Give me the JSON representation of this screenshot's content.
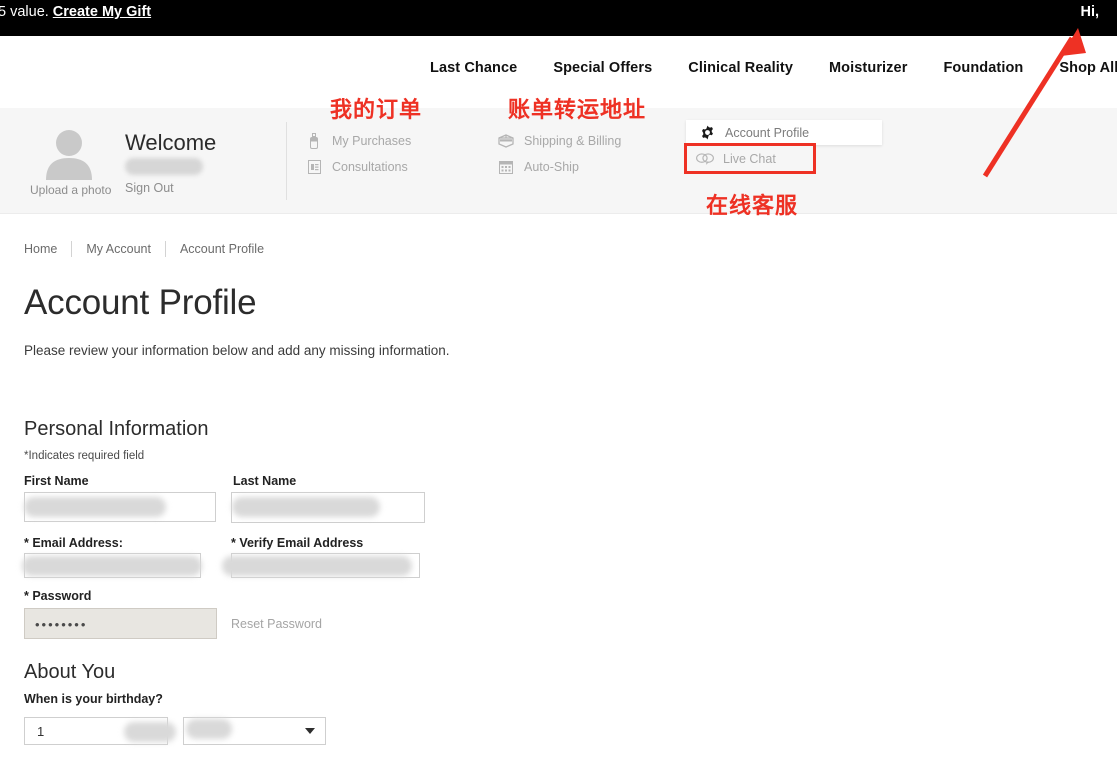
{
  "promo_bar": {
    "text": "5 value.",
    "link_label": "Create My Gift",
    "greeting": "Hi,"
  },
  "nav": {
    "items": [
      {
        "label": "Last Chance"
      },
      {
        "label": "Special Offers"
      },
      {
        "label": "Clinical Reality"
      },
      {
        "label": "Moisturizer"
      },
      {
        "label": "Foundation"
      },
      {
        "label": "Shop All"
      }
    ]
  },
  "account_band": {
    "upload_photo_label": "Upload a photo",
    "welcome_title": "Welcome",
    "sign_out_label": "Sign Out",
    "orders_column": [
      {
        "label": "My Purchases",
        "icon": "bottle-icon"
      },
      {
        "label": "Consultations",
        "icon": "document-icon"
      }
    ],
    "shipping_column": [
      {
        "label": "Shipping & Billing",
        "icon": "package-icon"
      },
      {
        "label": "Auto-Ship",
        "icon": "calendar-icon"
      }
    ],
    "dropdown": [
      {
        "label": "Account Profile",
        "icon": "gear-icon"
      },
      {
        "label": "Live Chat",
        "icon": "chat-bubble-icon"
      }
    ]
  },
  "annotations": {
    "orders_cn": "我的订单",
    "shipping_cn": "账单转运地址",
    "live_chat_cn": "在线客服",
    "color": "#ee3124"
  },
  "breadcrumb": {
    "items": [
      {
        "label": "Home"
      },
      {
        "label": "My Account"
      },
      {
        "label": "Account Profile"
      }
    ]
  },
  "page": {
    "title": "Account Profile",
    "subtitle": "Please review your information below and add any missing information."
  },
  "personal_information": {
    "heading": "Personal Information",
    "required_note": "*Indicates required field",
    "first_name_label": "First Name",
    "first_name_value": "",
    "last_name_label": "Last Name",
    "last_name_value": "",
    "email_label": "*  Email Address:",
    "email_value": "",
    "verify_email_label": "*  Verify Email Address",
    "verify_email_value": "",
    "password_label": "* Password",
    "password_value": "••••••••",
    "reset_password_label": "Reset Password"
  },
  "about_you": {
    "heading": "About You",
    "birthday_question": "When is your birthday?",
    "birth_month_value": "1",
    "birth_day_value": ""
  }
}
